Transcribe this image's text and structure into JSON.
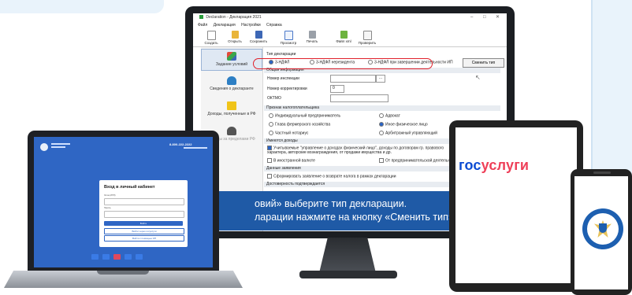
{
  "app": {
    "window_title": "Declaration - Декларация 2021",
    "menu": [
      "Файл",
      "Декларация",
      "Настройки",
      "Справка"
    ],
    "toolbar": [
      {
        "label": "Создать",
        "icon": "new-doc-icon"
      },
      {
        "label": "Открыть",
        "icon": "open-folder-icon"
      },
      {
        "label": "Сохранить",
        "icon": "save-icon"
      },
      {
        "label": "Просмотр",
        "icon": "preview-icon"
      },
      {
        "label": "Печать",
        "icon": "print-icon"
      },
      {
        "label": "Файл xml",
        "icon": "xml-file-icon"
      },
      {
        "label": "Проверить",
        "icon": "check-icon"
      }
    ],
    "sidebar": [
      {
        "label": "Задание условий",
        "active": true,
        "icon": "settings-shapes-icon"
      },
      {
        "label": "Сведения о декларанте",
        "active": false,
        "icon": "person-icon"
      },
      {
        "label": "Доходы, полученные в РФ",
        "active": false,
        "icon": "folder-icon"
      },
      {
        "label": "Доходы за пределами РФ",
        "active": false,
        "icon": "person-tie-icon"
      }
    ],
    "type_section": "Тип декларации",
    "type_options": [
      "3-НДФЛ",
      "3-НДФЛ нерезидента",
      "3-НДФЛ при завершении деятельности ИП"
    ],
    "change_type_button": "Сменить тип",
    "general_section": "Общая информация",
    "fields": {
      "inspection_label": "Номер инспекции",
      "correction_label": "Номер корректировки",
      "correction_value": "0",
      "oktmo_label": "ОКТМО"
    },
    "taxpayer_section": "Признак налогоплательщика",
    "taxpayer_options": [
      "Индивидуальный предприниматель",
      "Адвокат",
      "Глава фермерского хозяйства",
      "Иное физическое лицо",
      "Частный нотариус",
      "Арбитражный управляющий"
    ],
    "income_section": "Имеются доходы",
    "income_checked_text": "Учитываемые \"управление о доходах физический лицо\", доходы по договорам гр. правового характера, авторские вознаграждения, от продажи имущества и др.",
    "income_foreign": "В иностранной валюте",
    "income_business": "От предпринимательской деятельности",
    "data_section": "Данные заявления",
    "data_option": "Сформировать заявление о возврате налога в рамках декларации",
    "confirm_section": "Достоверность подтверждается",
    "banner_line1": "овий» выберите тип декларации.",
    "banner_line2": "ларации нажмите на кнопку «Сменить тип»"
  },
  "laptop": {
    "phone": "8-800-222-2222",
    "login_title": "Вход в личный кабинет",
    "login_field1": "Логин (ИНН)",
    "login_field2": "Пароль",
    "login_button": "Войти",
    "link_button1": "Войти через госуслуги",
    "link_button2": "Войти с помощью ЭП"
  },
  "tablet": {
    "logo_part1": "гос",
    "logo_part2": "услуги"
  },
  "colors": {
    "banner": "#1f5aa6",
    "gos_blue": "#0d4cd3",
    "gos_red": "#ee3f58",
    "highlight_red": "#e0202a"
  }
}
